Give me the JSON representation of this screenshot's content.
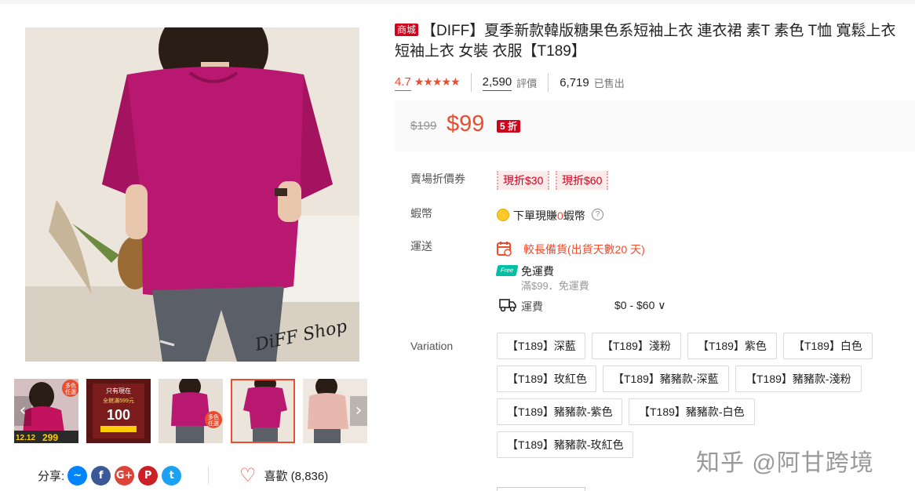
{
  "product": {
    "mall_badge": "商城",
    "title": "【DIFF】夏季新款韓版糖果色系短袖上衣 連衣裙 素T 素色 T恤 寬鬆上衣 短袖上衣 女裝 衣服【T189】",
    "rating": "4.7",
    "stars": "★★★★★",
    "review_count": "2,590",
    "review_label": "評價",
    "sold_count": "6,719",
    "sold_label": "已售出",
    "price_original": "$199",
    "price": "$99",
    "discount": "5 折"
  },
  "vouchers": {
    "label": "賣場折價券",
    "items": [
      "現折$30",
      "現折$60"
    ]
  },
  "coins": {
    "label": "蝦幣",
    "text_before": "下單現賺",
    "amount": "0",
    "text_after": "蝦幣",
    "help": "?"
  },
  "shipping": {
    "label": "運送",
    "warning": "較長備貨(出貨天數20 天)",
    "free_badge": "Free",
    "free_label": "免運費",
    "free_condition": "滿$99．免運費",
    "fee_label": "運費",
    "fee_range": "$0 - $60",
    "chevron": "∨"
  },
  "variation": {
    "label": "Variation",
    "options": [
      "【T189】深藍",
      "【T189】淺粉",
      "【T189】紫色",
      "【T189】白色",
      "【T189】玫紅色",
      "【T189】豬豬款-深藍",
      "【T189】豬豬款-淺粉",
      "【T189】豬豬款-紫色",
      "【T189】豬豬款-白色",
      "【T189】豬豬款-玫紅色"
    ]
  },
  "gallery": {
    "photo_caption": "DiFF Shop",
    "thumb1_badge": "多色\n任選",
    "thumb1_promo": "12.12",
    "thumb1_price": "299",
    "thumb2_text": "只有現在",
    "thumb2_sub": "全館滿599元",
    "thumb2_amount": "100",
    "thumb3_badge": "多色\n任選",
    "prev": "‹",
    "next": "›"
  },
  "share": {
    "label": "分享:",
    "icons": [
      "messenger-icon",
      "facebook-icon",
      "google-plus-icon",
      "pinterest-icon",
      "twitter-icon"
    ],
    "colors": [
      "#0084ff",
      "#3b5998",
      "#db4437",
      "#cb2027",
      "#1da1f2"
    ],
    "glyphs": [
      "~",
      "f",
      "G+",
      "P",
      "t"
    ]
  },
  "favorite": {
    "label": "喜歡 (8,836)"
  },
  "watermark": "知乎 @阿甘跨境",
  "colors": {
    "accent": "#ee4d2d",
    "mall_red": "#d0011b",
    "price_bg": "#fafafa",
    "shirt": "#b8186f"
  }
}
